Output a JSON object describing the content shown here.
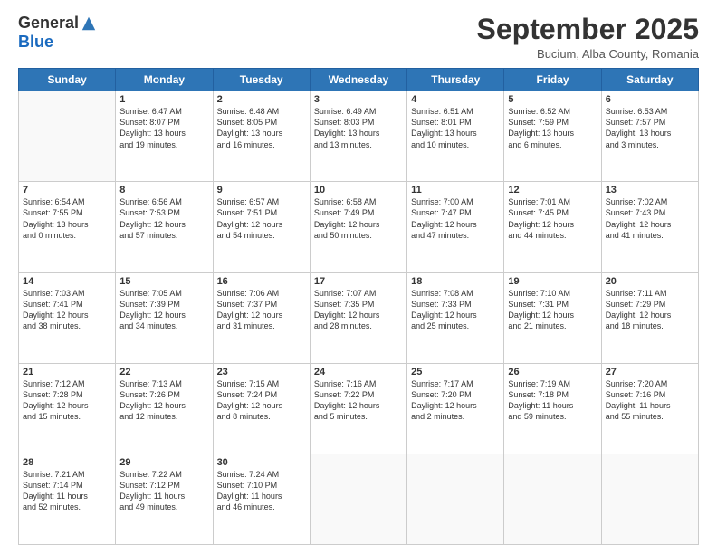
{
  "logo": {
    "general": "General",
    "blue": "Blue"
  },
  "title": "September 2025",
  "subtitle": "Bucium, Alba County, Romania",
  "header": {
    "days": [
      "Sunday",
      "Monday",
      "Tuesday",
      "Wednesday",
      "Thursday",
      "Friday",
      "Saturday"
    ]
  },
  "weeks": [
    [
      {
        "day": "",
        "info": ""
      },
      {
        "day": "1",
        "info": "Sunrise: 6:47 AM\nSunset: 8:07 PM\nDaylight: 13 hours\nand 19 minutes."
      },
      {
        "day": "2",
        "info": "Sunrise: 6:48 AM\nSunset: 8:05 PM\nDaylight: 13 hours\nand 16 minutes."
      },
      {
        "day": "3",
        "info": "Sunrise: 6:49 AM\nSunset: 8:03 PM\nDaylight: 13 hours\nand 13 minutes."
      },
      {
        "day": "4",
        "info": "Sunrise: 6:51 AM\nSunset: 8:01 PM\nDaylight: 13 hours\nand 10 minutes."
      },
      {
        "day": "5",
        "info": "Sunrise: 6:52 AM\nSunset: 7:59 PM\nDaylight: 13 hours\nand 6 minutes."
      },
      {
        "day": "6",
        "info": "Sunrise: 6:53 AM\nSunset: 7:57 PM\nDaylight: 13 hours\nand 3 minutes."
      }
    ],
    [
      {
        "day": "7",
        "info": "Sunrise: 6:54 AM\nSunset: 7:55 PM\nDaylight: 13 hours\nand 0 minutes."
      },
      {
        "day": "8",
        "info": "Sunrise: 6:56 AM\nSunset: 7:53 PM\nDaylight: 12 hours\nand 57 minutes."
      },
      {
        "day": "9",
        "info": "Sunrise: 6:57 AM\nSunset: 7:51 PM\nDaylight: 12 hours\nand 54 minutes."
      },
      {
        "day": "10",
        "info": "Sunrise: 6:58 AM\nSunset: 7:49 PM\nDaylight: 12 hours\nand 50 minutes."
      },
      {
        "day": "11",
        "info": "Sunrise: 7:00 AM\nSunset: 7:47 PM\nDaylight: 12 hours\nand 47 minutes."
      },
      {
        "day": "12",
        "info": "Sunrise: 7:01 AM\nSunset: 7:45 PM\nDaylight: 12 hours\nand 44 minutes."
      },
      {
        "day": "13",
        "info": "Sunrise: 7:02 AM\nSunset: 7:43 PM\nDaylight: 12 hours\nand 41 minutes."
      }
    ],
    [
      {
        "day": "14",
        "info": "Sunrise: 7:03 AM\nSunset: 7:41 PM\nDaylight: 12 hours\nand 38 minutes."
      },
      {
        "day": "15",
        "info": "Sunrise: 7:05 AM\nSunset: 7:39 PM\nDaylight: 12 hours\nand 34 minutes."
      },
      {
        "day": "16",
        "info": "Sunrise: 7:06 AM\nSunset: 7:37 PM\nDaylight: 12 hours\nand 31 minutes."
      },
      {
        "day": "17",
        "info": "Sunrise: 7:07 AM\nSunset: 7:35 PM\nDaylight: 12 hours\nand 28 minutes."
      },
      {
        "day": "18",
        "info": "Sunrise: 7:08 AM\nSunset: 7:33 PM\nDaylight: 12 hours\nand 25 minutes."
      },
      {
        "day": "19",
        "info": "Sunrise: 7:10 AM\nSunset: 7:31 PM\nDaylight: 12 hours\nand 21 minutes."
      },
      {
        "day": "20",
        "info": "Sunrise: 7:11 AM\nSunset: 7:29 PM\nDaylight: 12 hours\nand 18 minutes."
      }
    ],
    [
      {
        "day": "21",
        "info": "Sunrise: 7:12 AM\nSunset: 7:28 PM\nDaylight: 12 hours\nand 15 minutes."
      },
      {
        "day": "22",
        "info": "Sunrise: 7:13 AM\nSunset: 7:26 PM\nDaylight: 12 hours\nand 12 minutes."
      },
      {
        "day": "23",
        "info": "Sunrise: 7:15 AM\nSunset: 7:24 PM\nDaylight: 12 hours\nand 8 minutes."
      },
      {
        "day": "24",
        "info": "Sunrise: 7:16 AM\nSunset: 7:22 PM\nDaylight: 12 hours\nand 5 minutes."
      },
      {
        "day": "25",
        "info": "Sunrise: 7:17 AM\nSunset: 7:20 PM\nDaylight: 12 hours\nand 2 minutes."
      },
      {
        "day": "26",
        "info": "Sunrise: 7:19 AM\nSunset: 7:18 PM\nDaylight: 11 hours\nand 59 minutes."
      },
      {
        "day": "27",
        "info": "Sunrise: 7:20 AM\nSunset: 7:16 PM\nDaylight: 11 hours\nand 55 minutes."
      }
    ],
    [
      {
        "day": "28",
        "info": "Sunrise: 7:21 AM\nSunset: 7:14 PM\nDaylight: 11 hours\nand 52 minutes."
      },
      {
        "day": "29",
        "info": "Sunrise: 7:22 AM\nSunset: 7:12 PM\nDaylight: 11 hours\nand 49 minutes."
      },
      {
        "day": "30",
        "info": "Sunrise: 7:24 AM\nSunset: 7:10 PM\nDaylight: 11 hours\nand 46 minutes."
      },
      {
        "day": "",
        "info": ""
      },
      {
        "day": "",
        "info": ""
      },
      {
        "day": "",
        "info": ""
      },
      {
        "day": "",
        "info": ""
      }
    ]
  ]
}
